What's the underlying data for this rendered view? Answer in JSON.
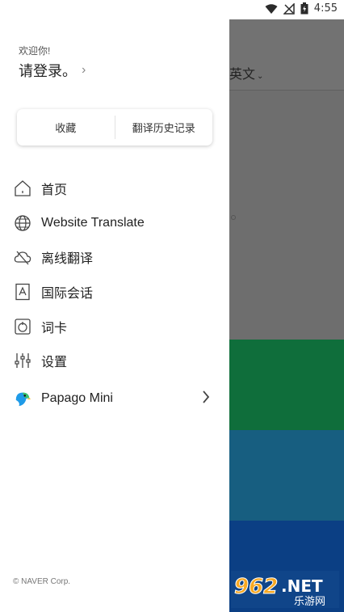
{
  "status_bar": {
    "time": "4:55",
    "icons": [
      "wifi-icon",
      "signal-icon",
      "battery-icon"
    ]
  },
  "background_app": {
    "language": "英文"
  },
  "drawer": {
    "welcome": "欢迎你!",
    "login": "请登录。",
    "segments": [
      {
        "label": "收藏"
      },
      {
        "label": "翻译历史记录"
      }
    ],
    "menu": [
      {
        "label": "首页",
        "icon": "home-icon"
      },
      {
        "label": "Website Translate",
        "icon": "globe-icon"
      },
      {
        "label": "离线翻译",
        "icon": "cloud-offline-icon"
      },
      {
        "label": "国际会话",
        "icon": "conversation-icon"
      },
      {
        "label": "词卡",
        "icon": "wordcard-icon"
      },
      {
        "label": "设置",
        "icon": "settings-sliders-icon"
      },
      {
        "label": "Papago Mini",
        "icon": "papago-parrot-icon"
      }
    ],
    "copyright": "© NAVER Corp."
  },
  "watermark": {
    "number": "962",
    "suffix": ".NET",
    "caption": "乐游网"
  },
  "colors": {
    "band_green": "#0f6e3b",
    "band_teal": "#175e80",
    "band_blue": "#0b3f84",
    "overlay_gray": "#6e6e6e"
  }
}
